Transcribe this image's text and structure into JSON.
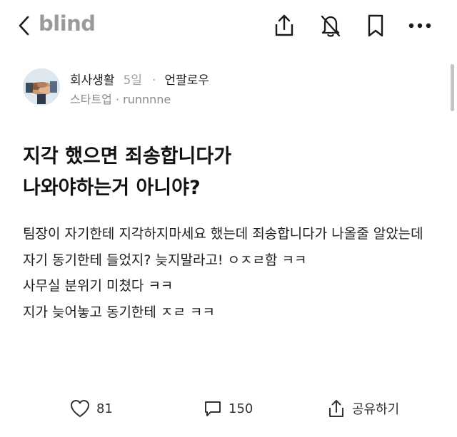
{
  "header": {
    "brand": "blind",
    "icons": [
      "back-chevron-icon",
      "share-icon",
      "bell-off-icon",
      "bookmark-icon",
      "more-icon"
    ]
  },
  "post": {
    "author": {
      "board": "회사생활",
      "time": "5일",
      "separator": "·",
      "follow_label": "언팔로우",
      "company_user": "스타트업 · runnnne"
    },
    "title_lines": [
      "지각 했으면 죄송합니다가",
      "나와야하는거 아니야?"
    ],
    "body_lines": [
      "팀장이 자기한테 지각하지마세요 했는데 죄송합니다가 나올줄 알았는데",
      "자기 동기한테 들었지? 늦지말라고! ㅇㅈㄹ함 ㅋㅋ",
      "사무실 분위기 미쳤다 ㅋㅋ",
      "지가 늦어놓고 동기한테 ㅈㄹ ㅋㅋ"
    ]
  },
  "actions": {
    "likes": "81",
    "comments": "150",
    "share_label": "공유하기"
  }
}
